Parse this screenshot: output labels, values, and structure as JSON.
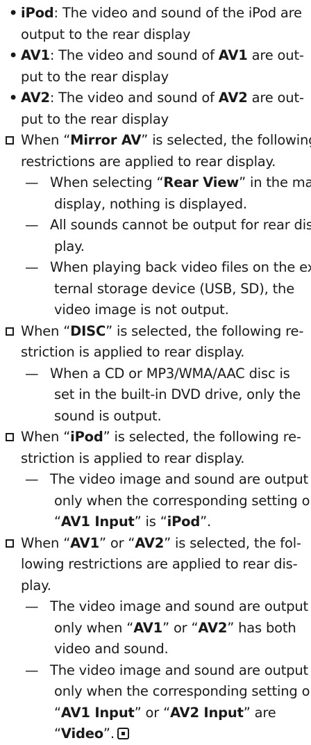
{
  "bullets": [
    {
      "term": "iPod",
      "lines": [
        ": The video and sound of the iPod are",
        "output to the rear display"
      ]
    },
    {
      "term": "AV1",
      "l1a": ": The video and sound of ",
      "l1b": " are out-",
      "l2": "put to the rear display"
    },
    {
      "term": "AV2",
      "l1a": ": The video and sound of ",
      "l1b": " are out-",
      "l2": "put to the rear display"
    }
  ],
  "mirror": {
    "l1a": "When “",
    "term": "Mirror AV",
    "l1b": "” is selected, the following",
    "l2": "restrictions are applied to rear display.",
    "d1a": "When selecting “",
    "d1term": "Rear View",
    "d1b": "” in the map",
    "d1l2": "display, nothing is displayed.",
    "d2l1": "All sounds cannot be output for rear dis-",
    "d2l2": "play.",
    "d3l1": "When playing back video files on the ex-",
    "d3l2": "ternal storage device (USB, SD), the",
    "d3l3": "video image is not output."
  },
  "disc": {
    "l1a": "When “",
    "term": "DISC",
    "l1b": "” is selected, the following re-",
    "l2": "striction is applied to rear display.",
    "d1l1": "When a CD or MP3/WMA/AAC disc is",
    "d1l2": "set in the built-in DVD drive, only the",
    "d1l3": "sound is output."
  },
  "ipod": {
    "l1a": "When “",
    "term": "iPod",
    "l1b": "” is selected, the following re-",
    "l2": "striction is applied to rear display.",
    "d1l1": "The video image and sound are output",
    "d1l2": "only when the corresponding setting on",
    "d1l3q1": "“",
    "d1l3t1": "AV1 Input",
    "d1l3m": "” is “",
    "d1l3t2": "iPod",
    "d1l3q2": "”."
  },
  "av": {
    "l1a": "When “",
    "t1": "AV1",
    "l1m": "” or “",
    "t2": "AV2",
    "l1b": "” is selected, the fol-",
    "l2": "lowing restrictions are applied to rear dis-",
    "l3": "play.",
    "d1l1": "The video image and sound are output",
    "d1l2a": "only when “",
    "d1t1": "AV1",
    "d1m": "” or “",
    "d1t2": "AV2",
    "d1l2b": "” has both",
    "d1l3": "video and sound.",
    "d2l1": "The video image and sound are output",
    "d2l2": "only when the corresponding setting on",
    "d2l3q1": "“",
    "d2t1": "AV1 Input",
    "d2m": "” or “",
    "d2t2": "AV2 Input",
    "d2l3b": "” are",
    "d2l4q1": "“",
    "d2t3": "Video",
    "d2l4q2": "”."
  },
  "glyphs": {
    "bullet": "•",
    "dash": "—"
  }
}
